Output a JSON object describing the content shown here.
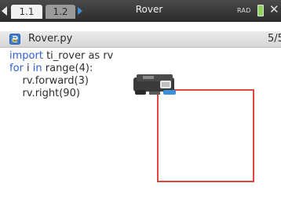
{
  "topbar": {
    "tabs": [
      {
        "label": "1.1",
        "active": true
      },
      {
        "label": "1.2",
        "active": false
      }
    ],
    "title": "Rover",
    "angle_mode": "RAD"
  },
  "file": {
    "name": "Rover.py",
    "line_count": "5/5"
  },
  "code": {
    "lines": [
      {
        "keyword": "import",
        "rest": " ti_rover as rv"
      },
      {
        "keyword": "for",
        "mid": " i ",
        "keyword2": "in",
        "rest": " range(4):"
      },
      {
        "text": "rv.forward(3)"
      },
      {
        "text": "rv.right(90)"
      }
    ]
  },
  "colors": {
    "path": "#e0463e",
    "keyword": "#2f5fd8",
    "tab_active": "#f2f2f2",
    "nav_arrow": "#3b8fd6"
  },
  "icons": {
    "nav_left": "chevron-left-icon",
    "nav_right": "chevron-right-icon",
    "battery": "battery-icon",
    "python_file": "python-file-icon",
    "close": "close-icon",
    "rover": "rover-icon"
  }
}
